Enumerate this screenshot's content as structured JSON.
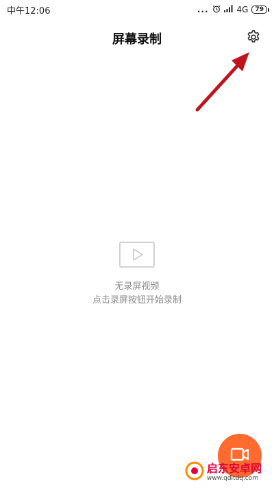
{
  "status_bar": {
    "time": "中午12:06",
    "dots": "...",
    "network": "4G",
    "battery": "79"
  },
  "header": {
    "title": "屏幕录制"
  },
  "empty_state": {
    "line1": "无录屏视频",
    "line2": "点击录屏按钮开始录制"
  },
  "watermark": {
    "title": "启东安卓网",
    "url": "www.qdltdq.com"
  },
  "colors": {
    "accent": "#ff6a2f",
    "annotation_arrow": "#c0141c",
    "watermark": "#e4003a"
  }
}
